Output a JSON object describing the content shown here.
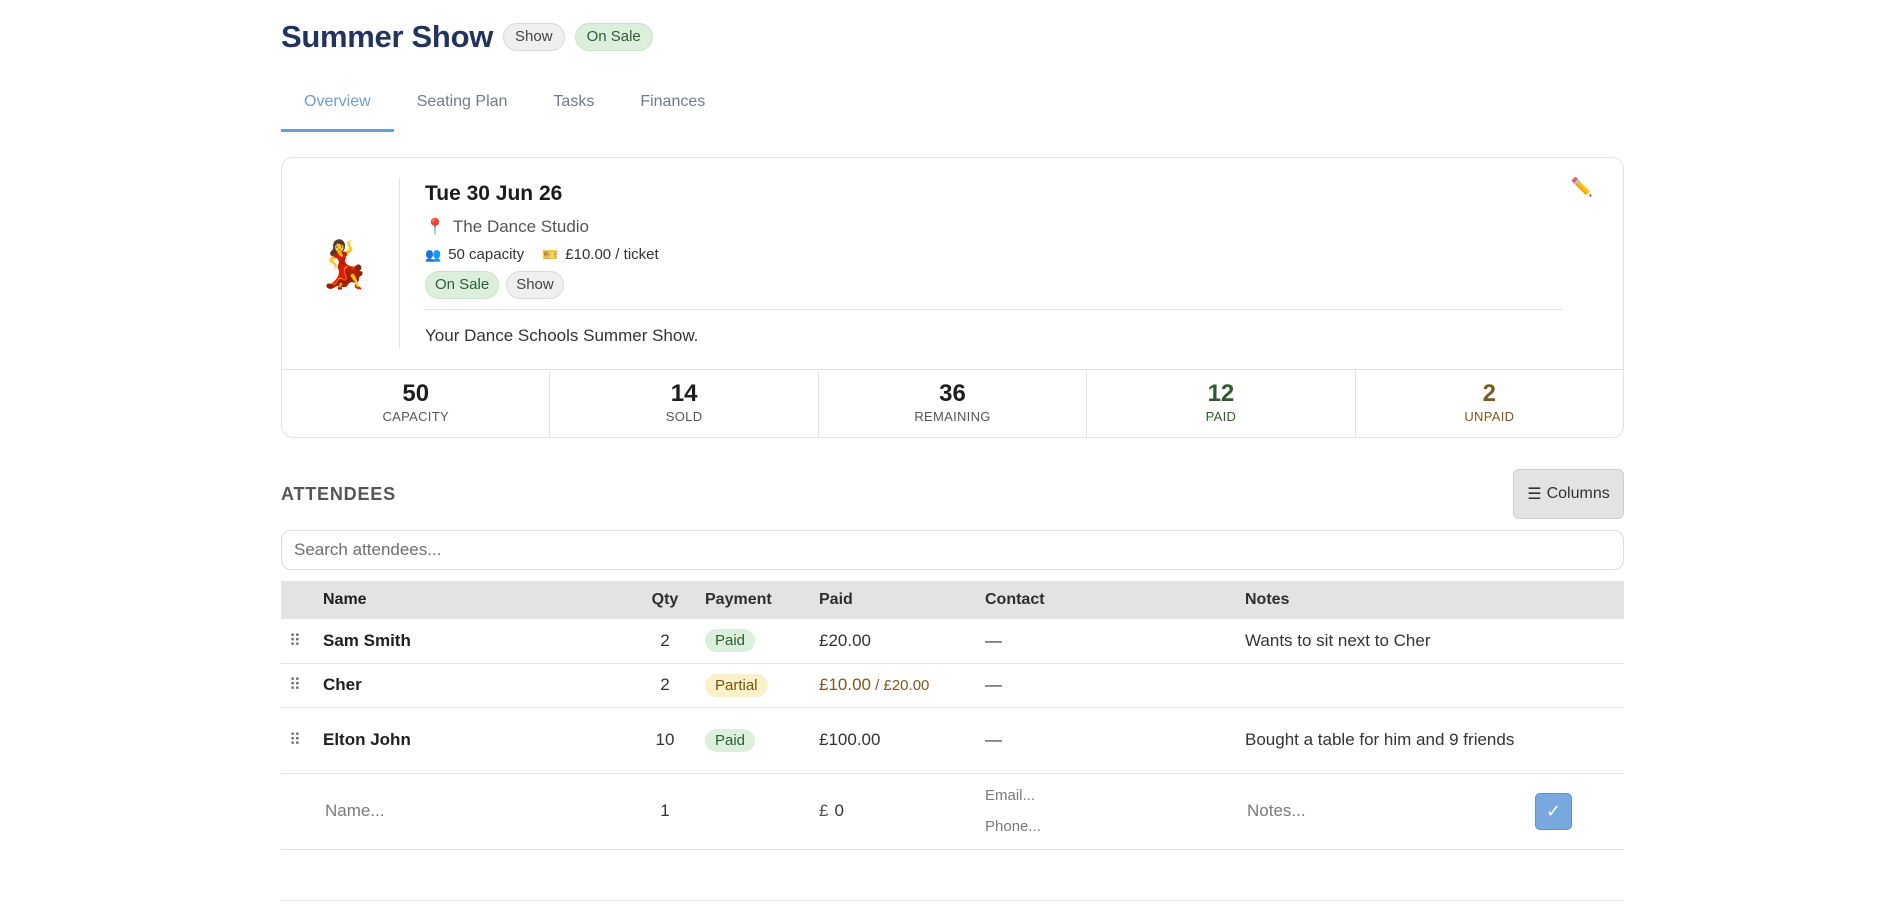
{
  "header": {
    "title": "Summer Show",
    "type_badge": "Show",
    "status_badge": "On Sale"
  },
  "tabs": [
    {
      "label": "Overview",
      "active": true
    },
    {
      "label": "Seating Plan",
      "active": false
    },
    {
      "label": "Tasks",
      "active": false
    },
    {
      "label": "Finances",
      "active": false
    }
  ],
  "event": {
    "emoji": "💃",
    "date": "Tue 30 Jun 26",
    "venue": "The Dance Studio",
    "capacity_text": "50 capacity",
    "price_text": "£10.00 / ticket",
    "status_badge": "On Sale",
    "type_badge": "Show",
    "description": "Your Dance Schools Summer Show."
  },
  "stats": [
    {
      "value": "50",
      "label": "CAPACITY"
    },
    {
      "value": "14",
      "label": "SOLD"
    },
    {
      "value": "36",
      "label": "REMAINING"
    },
    {
      "value": "12",
      "label": "PAID"
    },
    {
      "value": "2",
      "label": "UNPAID"
    }
  ],
  "attendees": {
    "heading": "ATTENDEES",
    "columns_button": "Columns",
    "search_placeholder": "Search attendees...",
    "headers": {
      "name": "Name",
      "qty": "Qty",
      "payment": "Payment",
      "paid": "Paid",
      "contact": "Contact",
      "notes": "Notes"
    },
    "rows": [
      {
        "name": "Sam Smith",
        "qty": "2",
        "payment": "Paid",
        "paid": "£20.00",
        "paid_total": "",
        "contact": "—",
        "notes": "Wants to sit next to Cher"
      },
      {
        "name": "Cher",
        "qty": "2",
        "payment": "Partial",
        "paid": "£10.00",
        "paid_total": " / £20.00",
        "contact": "—",
        "notes": ""
      },
      {
        "name": "Elton John",
        "qty": "10",
        "payment": "Paid",
        "paid": "£100.00",
        "paid_total": "",
        "contact": "—",
        "notes": "Bought a table for him and 9 friends"
      }
    ],
    "new_row": {
      "name_placeholder": "Name...",
      "qty_value": "1",
      "currency": "£",
      "paid_value": "0",
      "email_placeholder": "Email...",
      "phone_placeholder": "Phone...",
      "notes_placeholder": "Notes...",
      "confirm_glyph": "✓"
    }
  }
}
